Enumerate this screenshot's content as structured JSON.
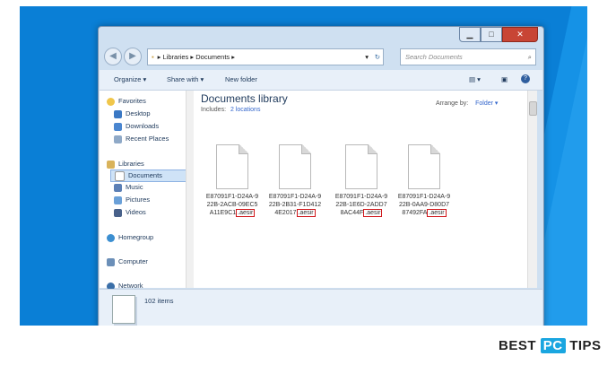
{
  "address_bar": {
    "path": [
      "Libraries",
      "Documents"
    ],
    "search_placeholder": "Search Documents"
  },
  "toolbar": {
    "organize": "Organize ▾",
    "share_with": "Share with ▾",
    "new_folder": "New folder"
  },
  "nav": {
    "favorites": "Favorites",
    "desktop": "Desktop",
    "downloads": "Downloads",
    "recent": "Recent Places",
    "libraries": "Libraries",
    "documents": "Documents",
    "music": "Music",
    "pictures": "Pictures",
    "videos": "Videos",
    "homegroup": "Homegroup",
    "computer": "Computer",
    "network": "Network"
  },
  "library": {
    "title": "Documents library",
    "includes_label": "Includes:",
    "includes_link": "2 locations",
    "arrange_label": "Arrange by:",
    "arrange_value": "Folder ▾"
  },
  "files": [
    {
      "l1": "E87091F1-D24A-9",
      "l2": "22B-2ACB-09EC5",
      "l3": "A11E9C1",
      "ext": ".aesir"
    },
    {
      "l1": "E87091F1-D24A-9",
      "l2": "22B-2B31-F1D412",
      "l3": "4E2017",
      "ext": ".aesir"
    },
    {
      "l1": "E87091F1-D24A-9",
      "l2": "22B-1E6D-2ADD7",
      "l3": "8AC44F",
      "ext": ".aesir"
    },
    {
      "l1": "E87091F1-D24A-9",
      "l2": "22B-0AA9-D80D7",
      "l3": "87492FA",
      "ext": ".aesir"
    }
  ],
  "details": {
    "count": "102 items"
  },
  "watermark": {
    "best": "BEST",
    "pc": "PC",
    "tips": "TIPS"
  },
  "colors": {
    "desktop": "#0a7fd6",
    "highlight": "#d0161a",
    "link": "#3366cc"
  }
}
